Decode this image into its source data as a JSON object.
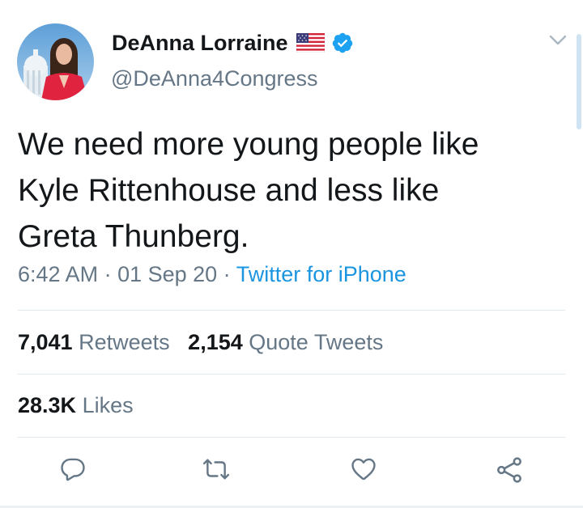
{
  "author": {
    "name": "DeAnna Lorraine",
    "handle": "@DeAnna4Congress",
    "flag_icon": "us-flag-icon",
    "verified_icon": "verified-badge-icon"
  },
  "tweet": {
    "line1": "We need more young people like",
    "line2": "Kyle Rittenhouse and less like",
    "line3": "Greta Thunberg."
  },
  "meta": {
    "time": "6:42 AM",
    "sep1": " · ",
    "date": "01 Sep 20",
    "sep2": " · ",
    "source": "Twitter for iPhone"
  },
  "stats": {
    "retweets_count": "7,041",
    "retweets_label": "Retweets",
    "quotes_count": "2,154",
    "quotes_label": "Quote Tweets",
    "likes_count": "28.3K",
    "likes_label": "Likes"
  },
  "actions": [
    "reply-icon",
    "retweet-icon",
    "like-icon",
    "share-icon"
  ],
  "colors": {
    "text": "#14171a",
    "secondary": "#657786",
    "link": "#1b95e0",
    "verified": "#1da1f2",
    "divider": "#e1e8ed"
  }
}
